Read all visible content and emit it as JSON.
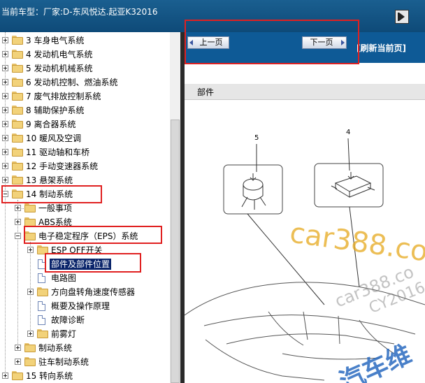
{
  "header": {
    "title": "当前车型：厂家:D-东风悦达.起亚K32016"
  },
  "tree": {
    "items": [
      {
        "label": "3 车身电气系统"
      },
      {
        "label": "4 发动机电气系统"
      },
      {
        "label": "5 发动机机械系统"
      },
      {
        "label": "6 发动机控制、燃油系统"
      },
      {
        "label": "7 废气排放控制系统"
      },
      {
        "label": "8 辅助保护系统"
      },
      {
        "label": "9 离合器系统"
      },
      {
        "label": "10 暖风及空调"
      },
      {
        "label": "11 驱动轴和车桥"
      },
      {
        "label": "12 手动变速器系统"
      },
      {
        "label": "13 悬架系统"
      },
      {
        "label": "14 制动系统"
      },
      {
        "label": "一般事项"
      },
      {
        "label": "ABS系统"
      },
      {
        "label": "电子稳定程序（EPS）系统"
      },
      {
        "label": "ESP OFF开关"
      },
      {
        "label": "部件及部件位置"
      },
      {
        "label": "电路图"
      },
      {
        "label": "方向盘转角速度传感器"
      },
      {
        "label": "概要及操作原理"
      },
      {
        "label": "故障诊断"
      },
      {
        "label": "前雾灯"
      },
      {
        "label": "制动系统"
      },
      {
        "label": "驻车制动系统"
      },
      {
        "label": "15 转向系统"
      }
    ]
  },
  "content": {
    "prev_label": "上一页",
    "next_label": "下一页",
    "refresh_label": "[刷新当前页]",
    "section_title": "部件",
    "diagram": {
      "callout_1": "5",
      "callout_2": "4"
    },
    "watermarks": {
      "w1": "car388.co",
      "w2": "car388.co",
      "w3": "CY2016",
      "w4": "汽车维"
    }
  }
}
